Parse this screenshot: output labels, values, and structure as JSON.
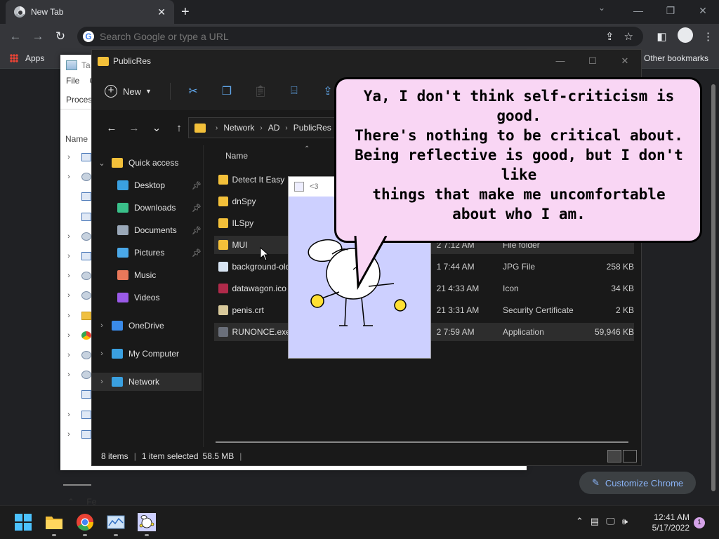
{
  "browser": {
    "tab_title": "New Tab",
    "omnibox_placeholder": "Search Google or type a URL",
    "bookmarks": {
      "apps_label": "Apps",
      "other_label": "Other bookmarks"
    },
    "customize_label": "Customize Chrome"
  },
  "taskmgr": {
    "title": "Ta",
    "menu": [
      "File",
      "O"
    ],
    "tab_label": "Proces",
    "column_name": "Name",
    "footer_label": "Fe",
    "rows": [
      {
        "chev": true,
        "icon": "window"
      },
      {
        "chev": true,
        "icon": "gear"
      },
      {
        "chev": false,
        "icon": "window"
      },
      {
        "chev": false,
        "icon": "window"
      },
      {
        "chev": true,
        "icon": "gear"
      },
      {
        "chev": true,
        "icon": "window"
      },
      {
        "chev": true,
        "icon": "gear"
      },
      {
        "chev": true,
        "icon": "gear"
      },
      {
        "chev": true,
        "icon": "folder"
      },
      {
        "chev": true,
        "icon": "chrome"
      },
      {
        "chev": true,
        "icon": "gear"
      },
      {
        "chev": true,
        "icon": "gear"
      },
      {
        "chev": false,
        "icon": "window"
      },
      {
        "chev": true,
        "icon": "window"
      },
      {
        "chev": true,
        "icon": "window"
      }
    ]
  },
  "explorer": {
    "title": "PublicRes",
    "new_label": "New",
    "breadcrumb": [
      "Network",
      "AD",
      "PublicRes"
    ],
    "column_name": "Name",
    "sidebar": [
      {
        "label": "Quick access",
        "icon": "star-icon",
        "color": "#f3c03a",
        "chev": "⌄",
        "indent": 0
      },
      {
        "label": "Desktop",
        "icon": "desktop-icon",
        "color": "#3aa0e0",
        "pinned": true,
        "indent": 1
      },
      {
        "label": "Downloads",
        "icon": "download-icon",
        "color": "#3ac08a",
        "pinned": true,
        "indent": 1
      },
      {
        "label": "Documents",
        "icon": "document-icon",
        "color": "#9aa8b8",
        "pinned": true,
        "indent": 1
      },
      {
        "label": "Pictures",
        "icon": "pictures-icon",
        "color": "#4aa8e8",
        "pinned": true,
        "indent": 1
      },
      {
        "label": "Music",
        "icon": "music-icon",
        "color": "#e8785a",
        "indent": 1
      },
      {
        "label": "Videos",
        "icon": "videos-icon",
        "color": "#9a5ae8",
        "indent": 1
      },
      {
        "label": "OneDrive",
        "icon": "cloud-icon",
        "color": "#3a8ae8",
        "chev": "›",
        "indent": 0
      },
      {
        "label": "My Computer",
        "icon": "computer-icon",
        "color": "#3aa0e0",
        "chev": "›",
        "indent": 0
      },
      {
        "label": "Network",
        "icon": "network-icon",
        "color": "#3aa0e0",
        "chev": "›",
        "indent": 0,
        "selected": true
      }
    ],
    "files": [
      {
        "name": "Detect It Easy",
        "date": "",
        "type": "",
        "size": "",
        "icon": "folder"
      },
      {
        "name": "dnSpy",
        "date": "",
        "type": "",
        "size": "",
        "icon": "folder"
      },
      {
        "name": "ILSpy",
        "date": "",
        "type": "",
        "size": "",
        "icon": "folder"
      },
      {
        "name": "MUI",
        "date": "2 7:12 AM",
        "type": "File folder",
        "size": "",
        "icon": "folder",
        "hover": true
      },
      {
        "name": "background-olc",
        "date": "1 7:44 AM",
        "type": "JPG File",
        "size": "258 KB",
        "icon": "image"
      },
      {
        "name": "datawagon.ico",
        "date": "21 4:33 AM",
        "type": "Icon",
        "size": "34 KB",
        "icon": "ico"
      },
      {
        "name": "penis.crt",
        "date": "21 3:31 AM",
        "type": "Security Certificate",
        "size": "2 KB",
        "icon": "cert"
      },
      {
        "name": "RUNONCE.exe",
        "date": "2 7:59 AM",
        "type": "Application",
        "size": "59,946 KB",
        "icon": "exe",
        "selected": true
      }
    ],
    "status": {
      "items": "8 items",
      "selected": "1 item selected",
      "size": "58.5 MB"
    }
  },
  "popup": {
    "title": "<3"
  },
  "bubble": {
    "lines": [
      "Ya, I don't think self-criticism is good.",
      "There's nothing to be critical about.",
      "Being reflective is good, but I don't like",
      "things that make me uncomfortable",
      "about who I am."
    ]
  },
  "taskbar": {
    "time": "12:41 AM",
    "date": "5/17/2022",
    "notifications": "1"
  }
}
